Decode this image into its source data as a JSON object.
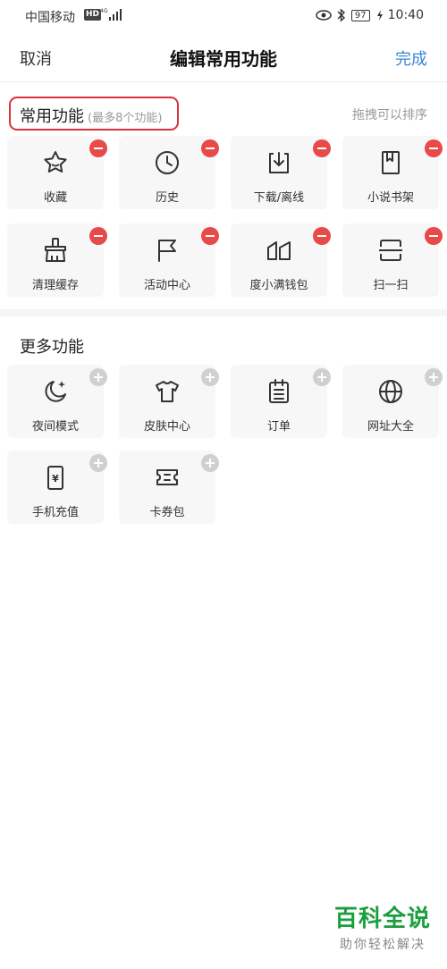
{
  "status_bar": {
    "carrier": "中国移动",
    "hd": "HD",
    "network": "4G",
    "battery": "97",
    "time": "10:40"
  },
  "nav": {
    "cancel": "取消",
    "title": "编辑常用功能",
    "done": "完成"
  },
  "common": {
    "title": "常用功能",
    "subtitle": "(最多8个功能)",
    "hint": "拖拽可以排序",
    "items": [
      {
        "label": "收藏",
        "icon": "star-icon"
      },
      {
        "label": "历史",
        "icon": "clock-icon"
      },
      {
        "label": "下载/离线",
        "icon": "download-icon"
      },
      {
        "label": "小说书架",
        "icon": "book-icon"
      },
      {
        "label": "清理缓存",
        "icon": "broom-icon"
      },
      {
        "label": "活动中心",
        "icon": "flag-icon"
      },
      {
        "label": "度小满钱包",
        "icon": "wallet-icon"
      },
      {
        "label": "扫一扫",
        "icon": "scan-icon"
      }
    ]
  },
  "more": {
    "title": "更多功能",
    "items": [
      {
        "label": "夜间模式",
        "icon": "moon-icon"
      },
      {
        "label": "皮肤中心",
        "icon": "shirt-icon"
      },
      {
        "label": "订单",
        "icon": "order-icon"
      },
      {
        "label": "网址大全",
        "icon": "globe-icon"
      },
      {
        "label": "手机充值",
        "icon": "phone-recharge-icon"
      },
      {
        "label": "卡券包",
        "icon": "coupon-icon"
      }
    ]
  },
  "watermark": {
    "main": "百科全说",
    "sub": "助你轻松解决"
  }
}
